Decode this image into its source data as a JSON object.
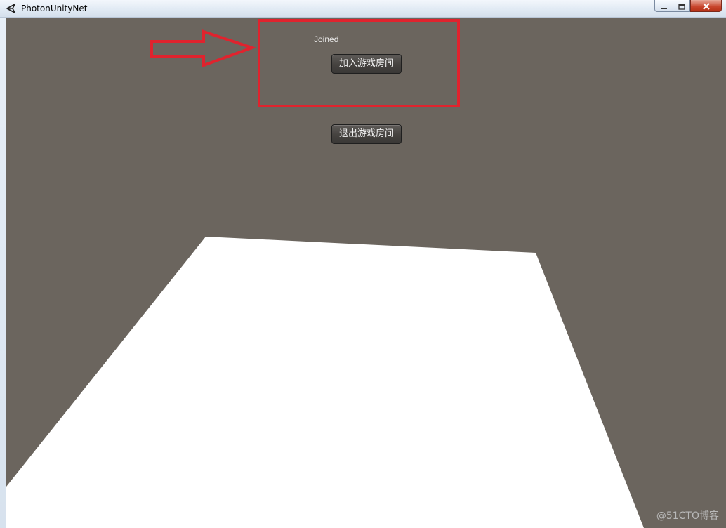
{
  "window": {
    "title": "PhotonUnityNet",
    "icon": "unity-icon",
    "controls": [
      "minimize-icon",
      "maximize-icon",
      "close-icon"
    ]
  },
  "game": {
    "status_label": "Joined",
    "join_button_label": "加入游戏房间",
    "leave_button_label": "退出游戏房间",
    "background_color": "#6b655e",
    "floor_color": "#ffffff"
  },
  "annotation": {
    "color": "#e0232e",
    "shapes": [
      "arrow-icon",
      "highlight-box"
    ]
  },
  "watermark": {
    "text": "@51CTO博客"
  }
}
